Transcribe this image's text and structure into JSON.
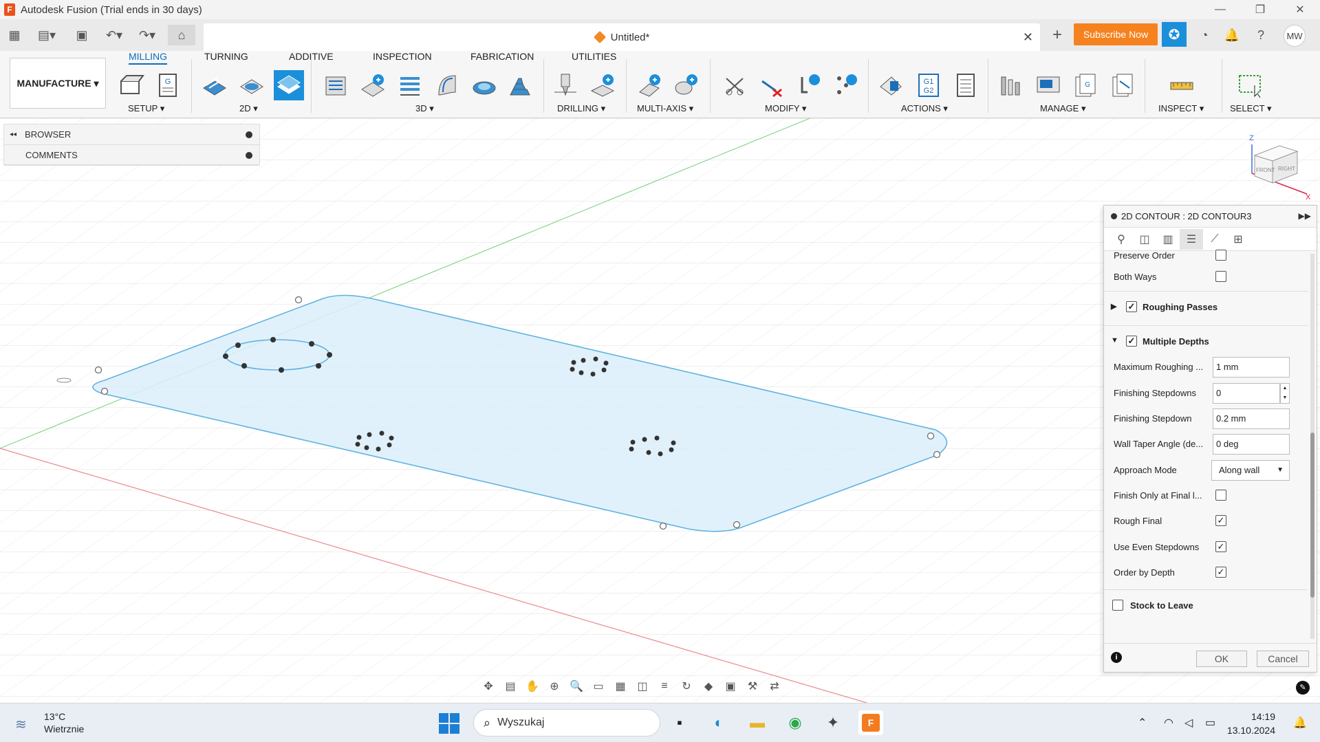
{
  "titlebar": {
    "title": "Autodesk Fusion (Trial ends in 30 days)",
    "logo_letter": "F",
    "controls": [
      "—",
      "❐",
      "✕"
    ]
  },
  "tabrow": {
    "doc_title": "Untitled*",
    "subscribe_label": "Subscribe Now",
    "avatar_initials": "MW"
  },
  "ribbon": {
    "workspace": "MANUFACTURE",
    "tabs": [
      "MILLING",
      "TURNING",
      "ADDITIVE",
      "INSPECTION",
      "FABRICATION",
      "UTILITIES"
    ],
    "active_tab": "MILLING",
    "groups": [
      "SETUP ▾",
      "2D ▾",
      "3D ▾",
      "DRILLING ▾",
      "MULTI-AXIS ▾",
      "MODIFY ▾",
      "ACTIONS ▾",
      "MANAGE ▾",
      "INSPECT ▾",
      "SELECT ▾"
    ]
  },
  "browser": {
    "rows": [
      "BROWSER",
      "COMMENTS"
    ]
  },
  "viewcube": {
    "front": "FRONT",
    "right": "RIGHT",
    "z": "Z",
    "x": "X"
  },
  "dialog": {
    "title": "2D CONTOUR : 2D CONTOUR3",
    "fields": {
      "preserve_order": {
        "label": "Preserve Order",
        "checked": false
      },
      "both_ways": {
        "label": "Both Ways",
        "checked": false
      },
      "roughing_passes": {
        "label": "Roughing Passes",
        "checked": true
      },
      "multiple_depths": {
        "label": "Multiple Depths",
        "checked": true
      },
      "max_roughing": {
        "label": "Maximum Roughing ...",
        "value": "1 mm"
      },
      "finishing_stepdowns": {
        "label": "Finishing Stepdowns",
        "value": "0"
      },
      "finishing_stepdown": {
        "label": "Finishing Stepdown",
        "value": "0.2 mm"
      },
      "wall_taper": {
        "label": "Wall Taper Angle (de...",
        "value": "0 deg"
      },
      "approach_mode": {
        "label": "Approach Mode",
        "value": "Along wall"
      },
      "finish_only_final": {
        "label": "Finish Only at Final l...",
        "checked": false
      },
      "rough_final": {
        "label": "Rough Final",
        "checked": true
      },
      "use_even_stepdowns": {
        "label": "Use Even Stepdowns",
        "checked": true
      },
      "order_by_depth": {
        "label": "Order by Depth",
        "checked": true
      },
      "stock_to_leave": {
        "label": "Stock to Leave",
        "checked": false
      }
    },
    "ok_label": "OK",
    "cancel_label": "Cancel"
  },
  "taskbar": {
    "temperature": "13°C",
    "weather": "Wietrznie",
    "search_placeholder": "Wyszukaj",
    "time": "14:19",
    "date": "13.10.2024"
  },
  "colors": {
    "accent": "#1c8fdb",
    "subscribe": "#f5821f",
    "sketch": "#5fb3e0"
  }
}
